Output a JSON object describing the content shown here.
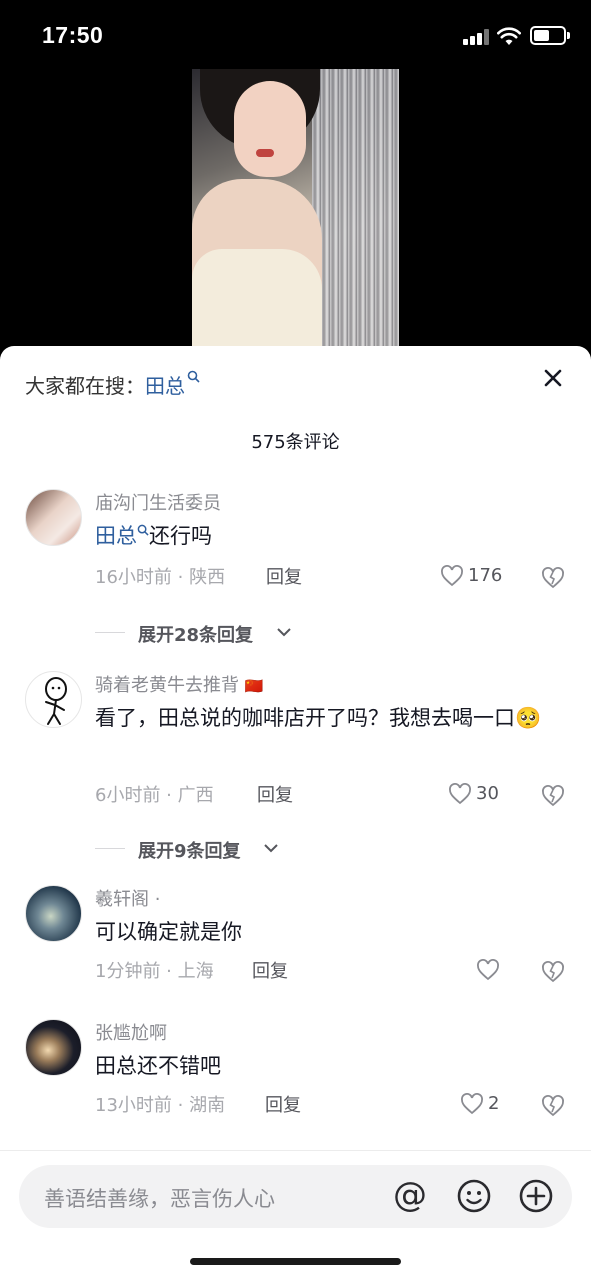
{
  "status_bar": {
    "time": "17:50",
    "battery_level": 0.55
  },
  "sheet": {
    "search_prefix": "大家都在搜：",
    "search_term": "田总",
    "comment_count": "575条评论"
  },
  "comments": [
    {
      "name": "庙沟门生活委员",
      "highlight": "田总",
      "text": "还行吗",
      "meta": "16小时前 · 陕西",
      "reply": "回复",
      "likes": "176",
      "expand": "展开28条回复"
    },
    {
      "name": "骑着老黄牛去推背",
      "flag": "🇨🇳",
      "text": "看了，田总说的咖啡店开了吗？我想去喝一口",
      "emoji": "🥺",
      "meta": "6小时前 · 广西",
      "reply": "回复",
      "likes": "30",
      "expand": "展开9条回复"
    },
    {
      "name": "羲轩阁 ·",
      "text": "可以确定就是你",
      "meta": "1分钟前 · 上海",
      "reply": "回复",
      "likes": ""
    },
    {
      "name": "张尴尬啊",
      "text": "田总还不错吧",
      "meta": "13小时前 · 湖南",
      "reply": "回复",
      "likes": "2"
    }
  ],
  "input": {
    "placeholder": "善语结善缘，恶言伤人心",
    "at_symbol": "@"
  },
  "icons": {
    "close": "close-icon",
    "like": "heart-outline-icon",
    "dislike": "broken-heart-icon",
    "emoji": "smiley-icon",
    "plus": "plus-circle-icon"
  },
  "colors": {
    "link": "#2f5f9e",
    "secondary": "#a7a8ad"
  }
}
